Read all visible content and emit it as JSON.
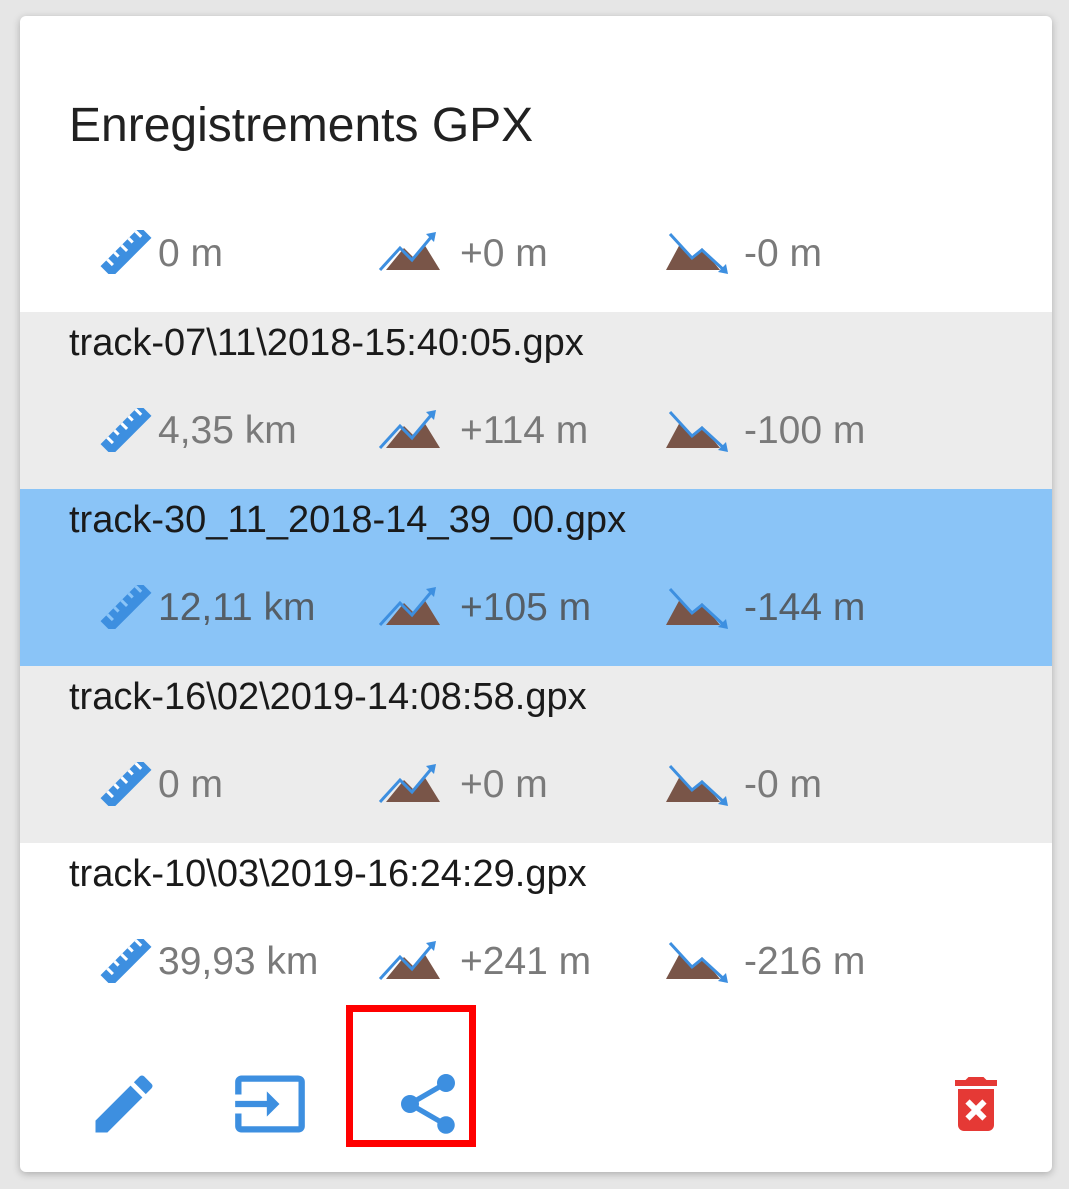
{
  "dialog": {
    "title": "Enregistrements GPX"
  },
  "tracks": [
    {
      "name": "",
      "distance": "0 m",
      "ascent": "+0 m",
      "descent": "-0 m",
      "background": "#ffffff",
      "selected": false
    },
    {
      "name": "track-07\\11\\2018-15:40:05.gpx",
      "distance": "4,35 km",
      "ascent": "+114 m",
      "descent": "-100 m",
      "background": "#ececec",
      "selected": false
    },
    {
      "name": "track-30_11_2018-14_39_00.gpx",
      "distance": "12,11 km",
      "ascent": "+105 m",
      "descent": "-144 m",
      "background": "#8ac4f7",
      "selected": true
    },
    {
      "name": "track-16\\02\\2019-14:08:58.gpx",
      "distance": "0 m",
      "ascent": "+0 m",
      "descent": "-0 m",
      "background": "#ececec",
      "selected": false
    },
    {
      "name": "track-10\\03\\2019-16:24:29.gpx",
      "distance": "39,93 km",
      "ascent": "+241 m",
      "descent": "-216 m",
      "background": "#ffffff",
      "selected": false
    }
  ],
  "icons": {
    "distance": "ruler-icon",
    "ascent": "ascent-mountain-icon",
    "descent": "descent-mountain-icon"
  },
  "actions": [
    {
      "icon": "pencil-icon",
      "label": "edit"
    },
    {
      "icon": "import-icon",
      "label": "import"
    },
    {
      "icon": "share-icon",
      "label": "share",
      "highlighted": true
    },
    {
      "icon": "trash-icon",
      "label": "delete"
    }
  ],
  "colors": {
    "accent": "#3d8fe0",
    "mountain": "#795548",
    "selected_row": "#8ac4f7",
    "alt_row": "#ececec",
    "delete": "#e53935",
    "highlight_box": "#ff0000"
  }
}
